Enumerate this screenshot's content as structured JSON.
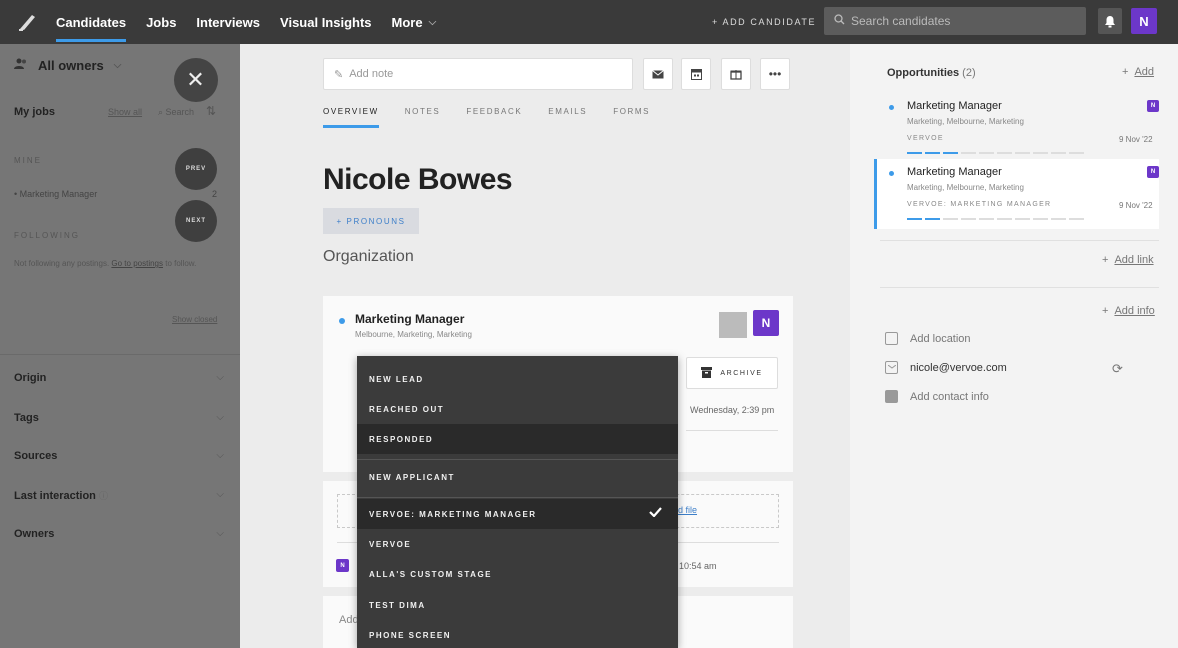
{
  "topbar": {
    "nav": [
      "Candidates",
      "Jobs",
      "Interviews",
      "Visual Insights"
    ],
    "more_label": "More",
    "add_candidate": "+ ADD CANDIDATE",
    "search_placeholder": "Search candidates",
    "avatar": "N"
  },
  "sidebar": {
    "owners": "All owners",
    "prev": "PREV",
    "next": "NEXT",
    "my_jobs": "My jobs",
    "show_all": "Show all",
    "search": "Search",
    "mine_label": "MINE",
    "job": "Marketing Manager",
    "job_count": "2",
    "following_label": "FOLLOWING",
    "not_following": "Not following any postings.",
    "go_to_postings": "Go to postings",
    "to_follow": "to follow.",
    "show_closed": "Show closed",
    "filters": [
      "Origin",
      "Tags",
      "Sources",
      "Last interaction",
      "Owners"
    ]
  },
  "main": {
    "note_placeholder": "Add note",
    "tabs": [
      "OVERVIEW",
      "NOTES",
      "FEEDBACK",
      "EMAILS",
      "FORMS"
    ],
    "candidate_name": "Nicole Bowes",
    "pronouns": "+ PRONOUNS",
    "organization": "Organization",
    "opportunity": {
      "title": "Marketing Manager",
      "subtitle": "Melbourne, Marketing, Marketing",
      "badge": "N",
      "archive": "ARCHIVE",
      "date": "Wednesday, 2:39 pm"
    },
    "file_link": "d file",
    "note_badge": "N",
    "note_time": "10:54 am",
    "add_text": "Add"
  },
  "dropdown": {
    "items": [
      "NEW LEAD",
      "REACHED OUT",
      "RESPONDED",
      "NEW APPLICANT",
      "VERVOE: MARKETING MANAGER",
      "VERVOE",
      "ALLA'S CUSTOM STAGE",
      "TEST DIMA",
      "PHONE SCREEN"
    ],
    "hovered": "RESPONDED",
    "selected": "VERVOE: MARKETING MANAGER"
  },
  "right": {
    "opps_title": "Opportunities",
    "opps_count": "(2)",
    "add": "Add",
    "opportunities": [
      {
        "title": "Marketing Manager",
        "subtitle": "Marketing, Melbourne, Marketing",
        "stage": "VERVOE",
        "date": "9 Nov '22",
        "badge": "N",
        "progress_steps": 10,
        "progress_done": 3
      },
      {
        "title": "Marketing Manager",
        "subtitle": "Marketing, Melbourne, Marketing",
        "stage": "VERVOE: MARKETING MANAGER",
        "date": "9 Nov '22",
        "badge": "N",
        "progress_steps": 10,
        "progress_done": 2
      }
    ],
    "add_link": "Add link",
    "add_info": "Add info",
    "add_location": "Add location",
    "email": "nicole@vervoe.com",
    "add_contact": "Add contact info"
  },
  "colors": {
    "accent": "#3d9be9",
    "brand": "#6c37c9",
    "topbar": "#3a3a3a",
    "dropdown": "#3b3b3b"
  }
}
